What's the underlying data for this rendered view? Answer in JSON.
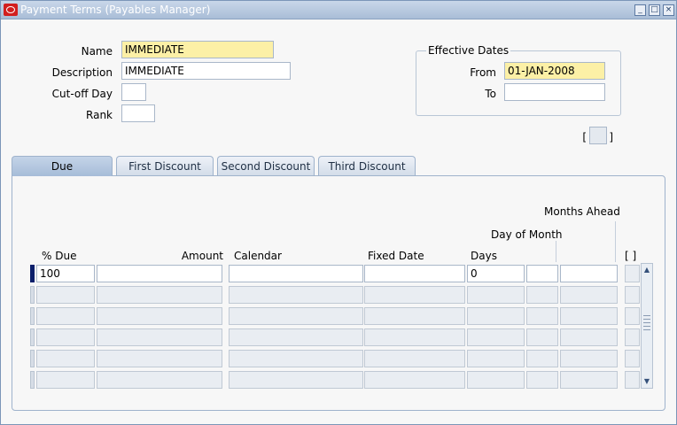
{
  "window": {
    "title": "Payment Terms (Payables Manager)",
    "buttons": {
      "minimize": "_",
      "maximize": "□",
      "close": "×"
    }
  },
  "form": {
    "name_label": "Name",
    "name_value": "IMMEDIATE",
    "description_label": "Description",
    "description_value": "IMMEDIATE",
    "cutoff_label": "Cut-off Day",
    "cutoff_value": "",
    "rank_label": "Rank",
    "rank_value": ""
  },
  "effective_dates": {
    "title": "Effective Dates",
    "from_label": "From",
    "from_value": "01-JAN-2008",
    "to_label": "To",
    "to_value": ""
  },
  "dff": {
    "open": "[",
    "close": "]"
  },
  "tabs": [
    {
      "label": "Due",
      "active": true
    },
    {
      "label": "First Discount",
      "active": false
    },
    {
      "label": "Second Discount",
      "active": false
    },
    {
      "label": "Third Discount",
      "active": false
    }
  ],
  "grid": {
    "headers": {
      "pct_due": "% Due",
      "amount": "Amount",
      "calendar": "Calendar",
      "fixed_date": "Fixed Date",
      "days": "Days",
      "day_of_month": "Day of Month",
      "months_ahead": "Months Ahead",
      "dff": "[ ]"
    },
    "rows": [
      {
        "pct_due": "100",
        "amount": "",
        "calendar": "",
        "fixed_date": "",
        "days": "0",
        "day_of_month": "",
        "months_ahead": ""
      },
      {
        "pct_due": "",
        "amount": "",
        "calendar": "",
        "fixed_date": "",
        "days": "",
        "day_of_month": "",
        "months_ahead": ""
      },
      {
        "pct_due": "",
        "amount": "",
        "calendar": "",
        "fixed_date": "",
        "days": "",
        "day_of_month": "",
        "months_ahead": ""
      },
      {
        "pct_due": "",
        "amount": "",
        "calendar": "",
        "fixed_date": "",
        "days": "",
        "day_of_month": "",
        "months_ahead": ""
      },
      {
        "pct_due": "",
        "amount": "",
        "calendar": "",
        "fixed_date": "",
        "days": "",
        "day_of_month": "",
        "months_ahead": ""
      },
      {
        "pct_due": "",
        "amount": "",
        "calendar": "",
        "fixed_date": "",
        "days": "",
        "day_of_month": "",
        "months_ahead": ""
      }
    ]
  },
  "scrollbar": {
    "up": "▲",
    "down": "▼"
  }
}
